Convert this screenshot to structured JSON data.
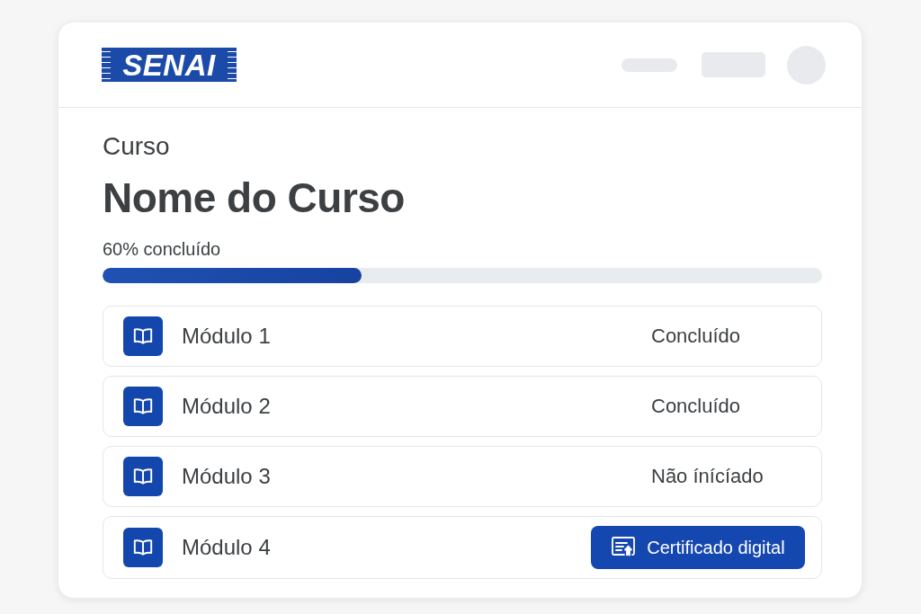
{
  "header": {
    "logo": "SENAI"
  },
  "course": {
    "eyebrow": "Curso",
    "title": "Nome do Curso",
    "progress": {
      "label": "60% concluído",
      "level": 0.36
    }
  },
  "modules": [
    {
      "title": "Módulo 1",
      "kind": "status",
      "status": "Concluído"
    },
    {
      "title": "Módulo 2",
      "kind": "status",
      "status": "Concluído"
    },
    {
      "title": "Módulo 3",
      "kind": "status",
      "status": "Não ínícíado"
    },
    {
      "title": "Módulo 4",
      "kind": "action",
      "button": "Certificado digital"
    }
  ]
}
